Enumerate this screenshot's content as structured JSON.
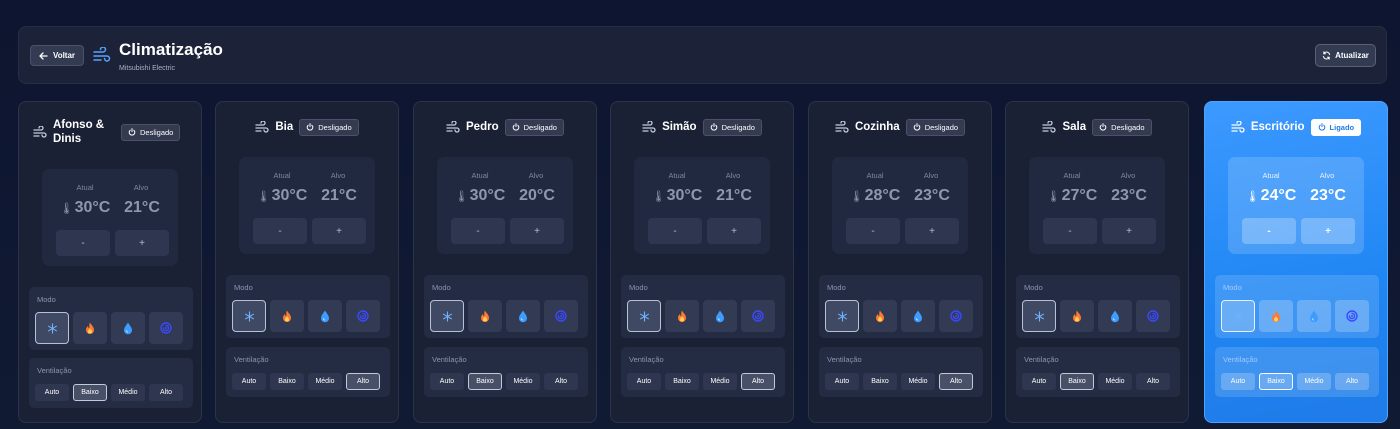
{
  "header": {
    "back_label": "Voltar",
    "title": "Climatização",
    "subtitle": "Mitsubishi Electric",
    "refresh_label": "Atualizar"
  },
  "labels": {
    "current": "Atual",
    "target": "Alvo",
    "minus": "-",
    "plus": "+",
    "mode": "Modo",
    "ventilation": "Ventilação"
  },
  "fan_options": [
    "Auto",
    "Baixo",
    "Médio",
    "Alto"
  ],
  "modes": [
    "snowflake-icon",
    "flame-icon",
    "droplet-icon",
    "swirl-icon"
  ],
  "colors": {
    "accent": "#1f86f3",
    "card": "#1a2134",
    "background": "#0d1530"
  },
  "rooms": [
    {
      "name": "Afonso & Dinis",
      "status": "Desligado",
      "on": false,
      "current": "30°C",
      "target": "21°C",
      "mode": 0,
      "fan": 1
    },
    {
      "name": "Bia",
      "status": "Desligado",
      "on": false,
      "current": "30°C",
      "target": "21°C",
      "mode": 0,
      "fan": 3
    },
    {
      "name": "Pedro",
      "status": "Desligado",
      "on": false,
      "current": "30°C",
      "target": "20°C",
      "mode": 0,
      "fan": 1
    },
    {
      "name": "Simão",
      "status": "Desligado",
      "on": false,
      "current": "30°C",
      "target": "21°C",
      "mode": 0,
      "fan": 3
    },
    {
      "name": "Cozinha",
      "status": "Desligado",
      "on": false,
      "current": "28°C",
      "target": "23°C",
      "mode": 0,
      "fan": 3
    },
    {
      "name": "Sala",
      "status": "Desligado",
      "on": false,
      "current": "27°C",
      "target": "23°C",
      "mode": 0,
      "fan": 1
    },
    {
      "name": "Escritório",
      "status": "Ligado",
      "on": true,
      "current": "24°C",
      "target": "23°C",
      "mode": 0,
      "fan": 1
    }
  ]
}
